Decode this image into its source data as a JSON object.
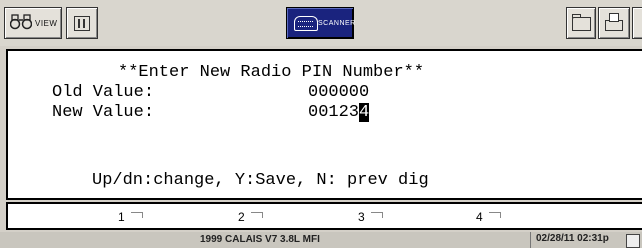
{
  "toolbar": {
    "view_label": "VIEW",
    "scanner_label": "SCANNER"
  },
  "screen": {
    "title": "**Enter New Radio PIN Number**",
    "old_label": "Old Value:",
    "old_value": "000000",
    "new_label": "New Value:",
    "new_value_prefix": "00123",
    "new_value_cursor": "4",
    "hint": "Up/dn:change, Y:Save, N: prev dig"
  },
  "softkeys": [
    "1",
    "2",
    "3",
    "4"
  ],
  "status": {
    "vehicle": "1999 CALAIS V7 3.8L MFI",
    "datetime": "02/28/11  02:31p"
  }
}
